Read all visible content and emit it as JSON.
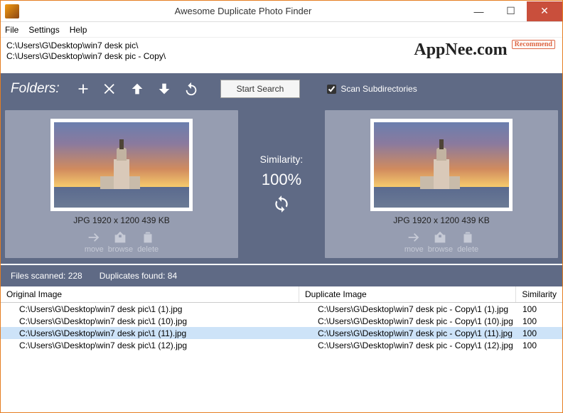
{
  "window": {
    "title": "Awesome Duplicate Photo Finder"
  },
  "menu": {
    "file": "File",
    "settings": "Settings",
    "help": "Help"
  },
  "paths": [
    "C:\\Users\\G\\Desktop\\win7 desk pic\\",
    "C:\\Users\\G\\Desktop\\win7 desk pic - Copy\\"
  ],
  "watermark": {
    "main": "AppNee.com",
    "badge": "Recommend"
  },
  "toolbar": {
    "label": "Folders:",
    "start_search": "Start Search",
    "scan_sub": "Scan Subdirectories",
    "scan_sub_checked": true
  },
  "similarity": {
    "label": "Similarity:",
    "value": "100%"
  },
  "preview": {
    "left_meta": "JPG   1920 x 1200   439 KB",
    "right_meta": "JPG   1920 x 1200   439 KB",
    "actions": {
      "move": "move",
      "browse": "browse",
      "delete": "delete"
    }
  },
  "stats": {
    "files_scanned": "Files scanned: 228",
    "dupes_found": "Duplicates found: 84"
  },
  "results": {
    "headers": {
      "original": "Original Image",
      "duplicate": "Duplicate Image",
      "similarity": "Similarity"
    },
    "rows": [
      {
        "orig": "C:\\Users\\G\\Desktop\\win7 desk pic\\1 (1).jpg",
        "dup": "C:\\Users\\G\\Desktop\\win7 desk pic - Copy\\1 (1).jpg",
        "sim": "100",
        "selected": false
      },
      {
        "orig": "C:\\Users\\G\\Desktop\\win7 desk pic\\1 (10).jpg",
        "dup": "C:\\Users\\G\\Desktop\\win7 desk pic - Copy\\1 (10).jpg",
        "sim": "100",
        "selected": false
      },
      {
        "orig": "C:\\Users\\G\\Desktop\\win7 desk pic\\1 (11).jpg",
        "dup": "C:\\Users\\G\\Desktop\\win7 desk pic - Copy\\1 (11).jpg",
        "sim": "100",
        "selected": true
      },
      {
        "orig": "C:\\Users\\G\\Desktop\\win7 desk pic\\1 (12).jpg",
        "dup": "C:\\Users\\G\\Desktop\\win7 desk pic - Copy\\1 (12).jpg",
        "sim": "100",
        "selected": false
      }
    ]
  }
}
